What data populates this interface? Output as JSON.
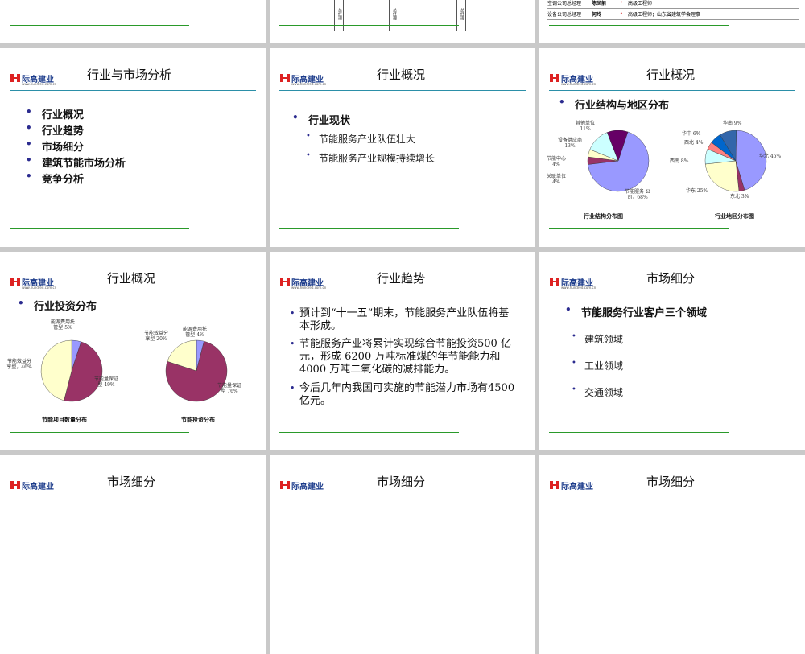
{
  "brand": {
    "name": "际高建业",
    "url": "www.hundred.com.cn"
  },
  "slide_top_right": {
    "rows": [
      {
        "role": "空调公司总经理",
        "name": "陈凤前",
        "desc": "高级工程师"
      },
      {
        "role": "设备公司总经理",
        "name": "何玲",
        "desc": "高级工程师；山东省建筑学会理事"
      }
    ]
  },
  "slide_top_middle": {
    "box_labels": [
      "总经理",
      "总经理",
      "总经理"
    ]
  },
  "s1": {
    "title": "行业与市场分析",
    "items": [
      "行业概况",
      "行业趋势",
      "市场细分",
      "建筑节能市场分析",
      "竞争分析"
    ]
  },
  "s2": {
    "title": "行业概况",
    "heading": "行业现状",
    "items": [
      "节能服务产业队伍壮大",
      "节能服务产业规模持续增长"
    ]
  },
  "s3": {
    "title": "行业概况",
    "heading": "行业结构与地区分布",
    "pie1": {
      "caption": "行业结构分布图",
      "labels": [
        "其他单位 11%",
        "设备供应商 13%",
        "节能中心 4%",
        "关联单位 4%",
        "节能服务 公司，68%"
      ]
    },
    "pie2": {
      "caption": "行业地区分布图",
      "labels": [
        "华南 9%",
        "华中 6%",
        "西北 4%",
        "西南 8%",
        "华东 25%",
        "东北 3%",
        "华北 45%"
      ]
    }
  },
  "s4": {
    "title": "行业概况",
    "heading": "行业投资分布",
    "pie1": {
      "caption": "节能项目数量分布",
      "labels": [
        "能源费用托管型 5%",
        "节能效益分享型，46%",
        "节能量保证型 49%"
      ]
    },
    "pie2": {
      "caption": "节能投资分布",
      "labels": [
        "能源费用托管型 4%",
        "节能效益分享型 20%",
        "节能量保证型 76%"
      ]
    }
  },
  "s5": {
    "title": "行业趋势",
    "paras": [
      "预计到“十一五”期末，节能服务产业队伍将基本形成。",
      "节能服务产业将累计实现综合节能投资500 亿元，形成 6200 万吨标准煤的年节能能力和 4000 万吨二氧化碳的减排能力。",
      "今后几年内我国可实施的节能潜力市场有4500 亿元。"
    ]
  },
  "s6": {
    "title": "市场细分",
    "heading": "节能服务行业客户三个领域",
    "items": [
      "建筑领域",
      "工业领域",
      "交通领域"
    ]
  },
  "bottom": {
    "titles": [
      "市场细分",
      "市场细分",
      "市场细分"
    ]
  },
  "chart_data": [
    {
      "type": "pie",
      "title": "行业结构分布图",
      "categories": [
        "节能服务公司",
        "关联单位",
        "节能中心",
        "设备供应商",
        "其他单位"
      ],
      "values": [
        68,
        4,
        4,
        13,
        11
      ]
    },
    {
      "type": "pie",
      "title": "行业地区分布图",
      "categories": [
        "华北",
        "东北",
        "华东",
        "西南",
        "西北",
        "华中",
        "华南"
      ],
      "values": [
        45,
        3,
        25,
        8,
        4,
        6,
        9
      ]
    },
    {
      "type": "pie",
      "title": "节能项目数量分布",
      "categories": [
        "能源费用托管型",
        "节能量保证型",
        "节能效益分享型"
      ],
      "values": [
        5,
        49,
        46
      ]
    },
    {
      "type": "pie",
      "title": "节能投资分布",
      "categories": [
        "能源费用托管型",
        "节能量保证型",
        "节能效益分享型"
      ],
      "values": [
        4,
        76,
        20
      ]
    }
  ]
}
